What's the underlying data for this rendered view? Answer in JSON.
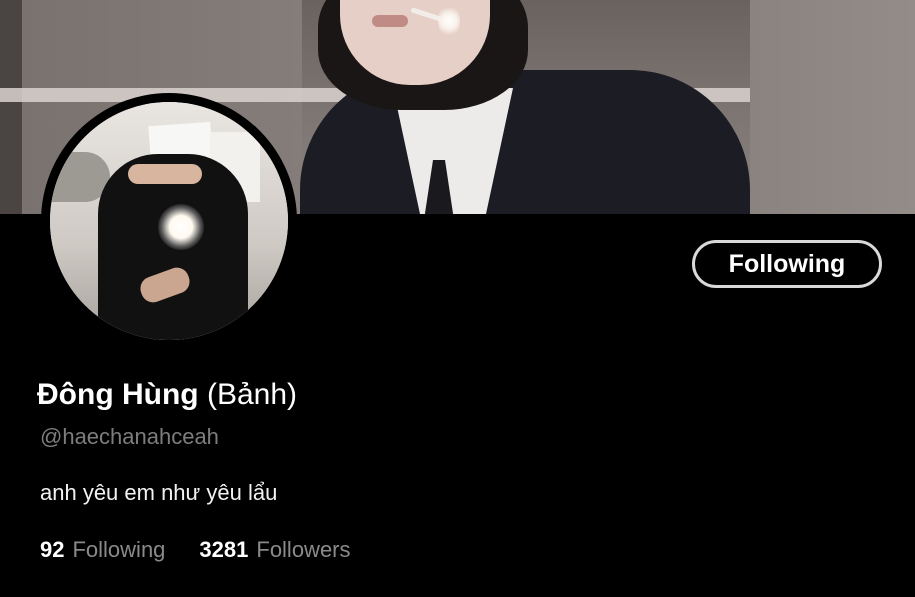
{
  "profile": {
    "display_name": "Đông Hùng",
    "nickname": "(Bảnh)",
    "handle": "@haechanahceah",
    "bio": "anh yêu em như yêu lẩu"
  },
  "actions": {
    "follow_button_label": "Following"
  },
  "stats": {
    "following_count": "92",
    "following_label": "Following",
    "followers_count": "3281",
    "followers_label": "Followers"
  },
  "theme": {
    "background": "#000000",
    "text_primary": "#ffffff",
    "text_secondary": "#7d7d7d",
    "button_border": "#d9d9d9"
  }
}
